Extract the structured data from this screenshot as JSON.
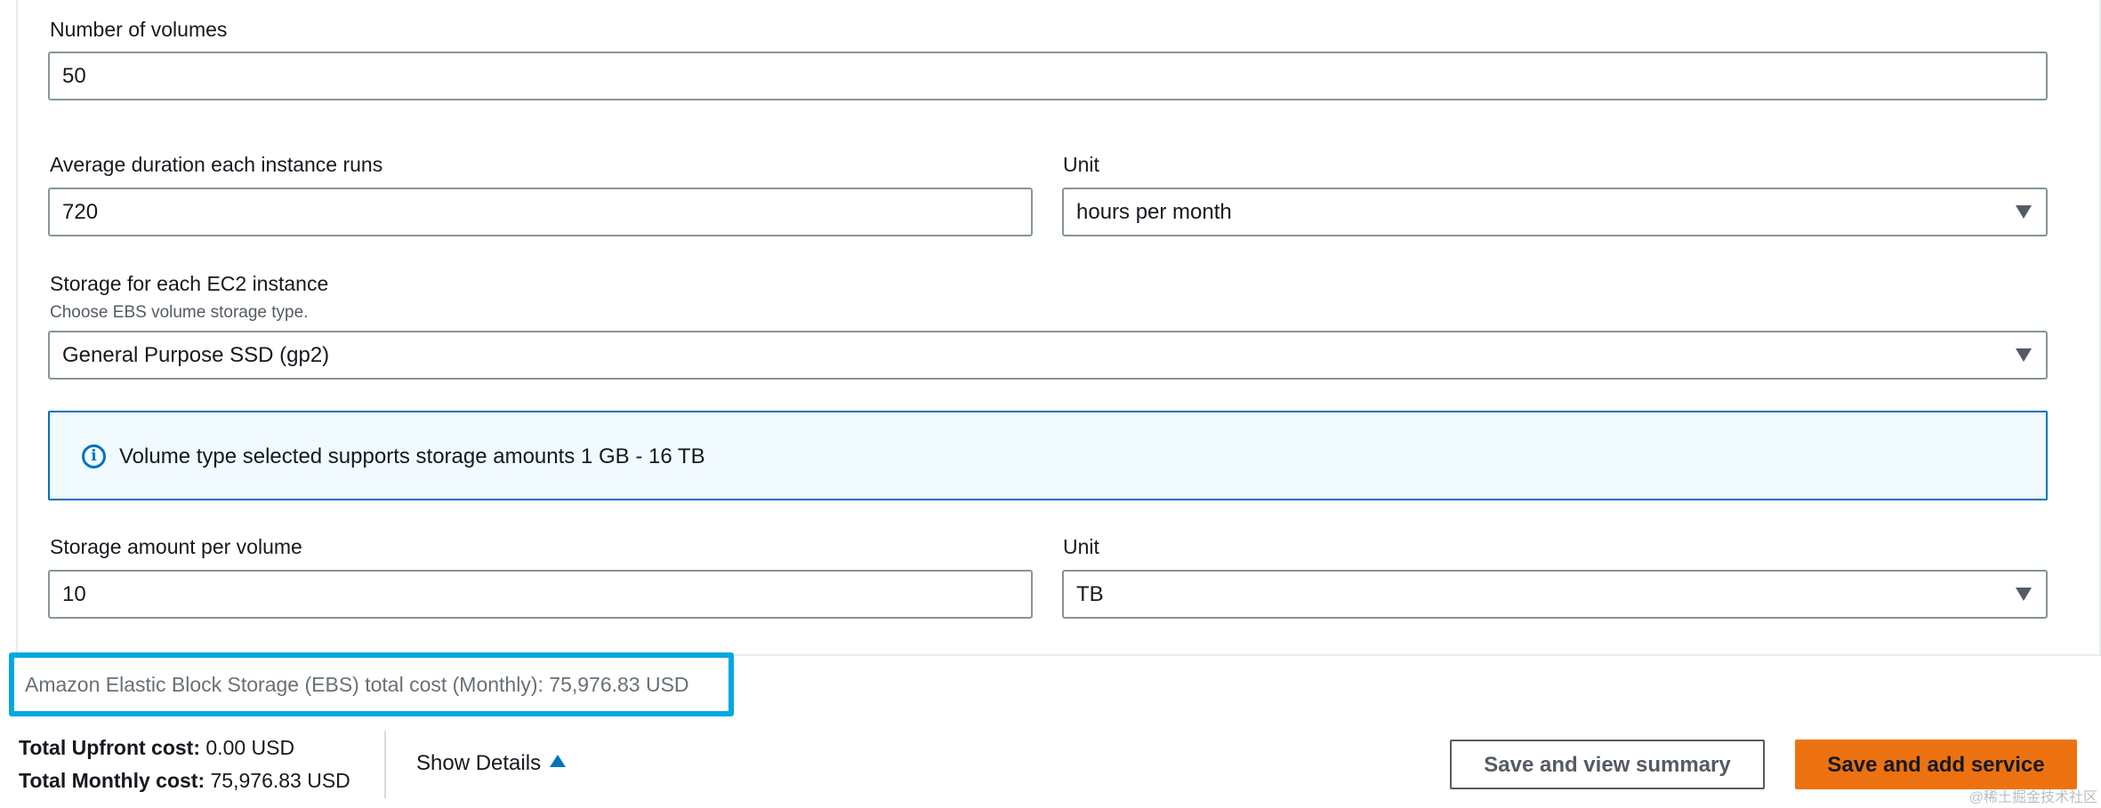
{
  "form": {
    "volumes": {
      "label": "Number of volumes",
      "value": "50"
    },
    "duration": {
      "label": "Average duration each instance runs",
      "value": "720",
      "unit_label": "Unit",
      "unit_value": "hours per month"
    },
    "storage": {
      "label": "Storage for each EC2 instance",
      "hint": "Choose EBS volume storage type.",
      "value": "General Purpose SSD (gp2)"
    },
    "info": {
      "icon": "info-icon",
      "text": "Volume type selected supports storage amounts 1 GB - 16 TB"
    },
    "amount": {
      "label": "Storage amount per volume",
      "value": "10",
      "unit_label": "Unit",
      "unit_value": "TB"
    }
  },
  "service_cost": "Amazon Elastic Block Storage (EBS) total cost (Monthly): 75,976.83 USD",
  "footer": {
    "upfront_label": "Total Upfront cost:",
    "upfront_value": "0.00 USD",
    "monthly_label": "Total Monthly cost:",
    "monthly_value": "75,976.83 USD",
    "show_details": "Show Details",
    "save_summary": "Save and view summary",
    "save_add": "Save and add service"
  },
  "watermark": "@稀土掘金技术社区",
  "colors": {
    "accent": "#0073bb",
    "primary_button": "#ec7211",
    "highlight": "#00a8e1"
  }
}
